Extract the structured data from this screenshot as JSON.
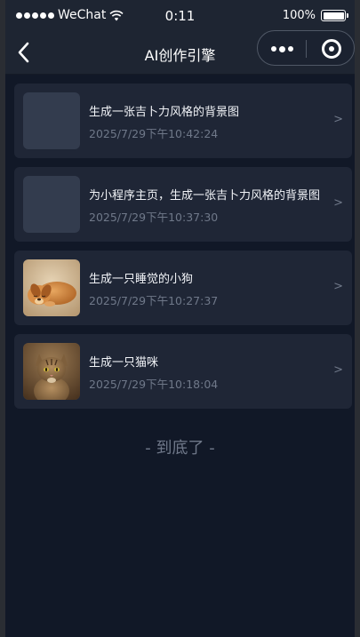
{
  "status_bar": {
    "carrier": "WeChat",
    "time": "0:11",
    "battery": "100%"
  },
  "nav": {
    "title": "AI创作引擎"
  },
  "items": [
    {
      "title": "生成一张吉卜力风格的背景图",
      "time": "2025/7/29下午10:42:24",
      "thumbnail": "placeholder",
      "arrow": ">"
    },
    {
      "title": "为小程序主页，生成一张吉卜力风格的背景图",
      "time": "2025/7/29下午10:37:30",
      "thumbnail": "placeholder",
      "arrow": ">"
    },
    {
      "title": "生成一只睡觉的小狗",
      "time": "2025/7/29下午10:27:37",
      "thumbnail": "sleeping-puppy-image",
      "arrow": ">"
    },
    {
      "title": "生成一只猫咪",
      "time": "2025/7/29下午10:18:04",
      "thumbnail": "tabby-cat-image",
      "arrow": ">"
    }
  ],
  "footer": {
    "end_text": "- 到底了 -"
  },
  "colors": {
    "background": "#111827",
    "card": "#1f2636",
    "nav": "#1e2532",
    "muted_text": "#6f7889"
  }
}
